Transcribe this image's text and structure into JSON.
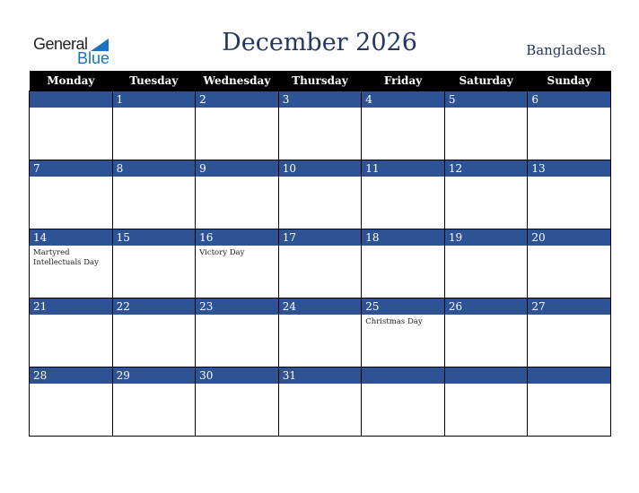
{
  "logo": {
    "line1": "General",
    "line2": "Blue"
  },
  "title": "December 2026",
  "country": "Bangladesh",
  "weekdays": [
    "Monday",
    "Tuesday",
    "Wednesday",
    "Thursday",
    "Friday",
    "Saturday",
    "Sunday"
  ],
  "weeks": [
    [
      {
        "d": "",
        "h": ""
      },
      {
        "d": "1",
        "h": ""
      },
      {
        "d": "2",
        "h": ""
      },
      {
        "d": "3",
        "h": ""
      },
      {
        "d": "4",
        "h": ""
      },
      {
        "d": "5",
        "h": ""
      },
      {
        "d": "6",
        "h": ""
      }
    ],
    [
      {
        "d": "7",
        "h": ""
      },
      {
        "d": "8",
        "h": ""
      },
      {
        "d": "9",
        "h": ""
      },
      {
        "d": "10",
        "h": ""
      },
      {
        "d": "11",
        "h": ""
      },
      {
        "d": "12",
        "h": ""
      },
      {
        "d": "13",
        "h": ""
      }
    ],
    [
      {
        "d": "14",
        "h": "Martyred Intellectuals Day"
      },
      {
        "d": "15",
        "h": ""
      },
      {
        "d": "16",
        "h": "Victory Day"
      },
      {
        "d": "17",
        "h": ""
      },
      {
        "d": "18",
        "h": ""
      },
      {
        "d": "19",
        "h": ""
      },
      {
        "d": "20",
        "h": ""
      }
    ],
    [
      {
        "d": "21",
        "h": ""
      },
      {
        "d": "22",
        "h": ""
      },
      {
        "d": "23",
        "h": ""
      },
      {
        "d": "24",
        "h": ""
      },
      {
        "d": "25",
        "h": "Christmas Day"
      },
      {
        "d": "26",
        "h": ""
      },
      {
        "d": "27",
        "h": ""
      }
    ],
    [
      {
        "d": "28",
        "h": ""
      },
      {
        "d": "29",
        "h": ""
      },
      {
        "d": "30",
        "h": ""
      },
      {
        "d": "31",
        "h": ""
      },
      {
        "d": "",
        "h": ""
      },
      {
        "d": "",
        "h": ""
      },
      {
        "d": "",
        "h": ""
      }
    ]
  ],
  "colors": {
    "header_bg": "#000000",
    "date_bar": "#2e5395",
    "title": "#24385f",
    "logo_blue": "#1a73c0"
  }
}
